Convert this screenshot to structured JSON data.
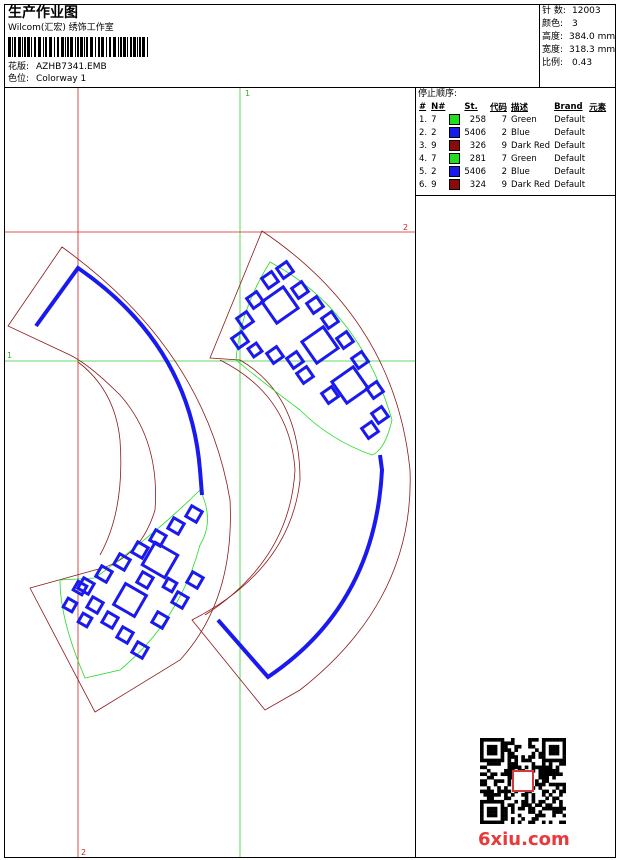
{
  "header": {
    "title": "生产作业图",
    "company": "Wilcom(汇宏) 绣饰工作室",
    "design_label": "花版:",
    "design_value": "AZHB7341.EMB",
    "colorway_label": "色位:",
    "colorway_value": "Colorway 1"
  },
  "stats": {
    "stitches_label": "针 数:",
    "stitches_value": "12003",
    "colors_label": "颜色:",
    "colors_value": "3",
    "height_label": "高度:",
    "height_value": "384.0 mm",
    "width_label": "宽度:",
    "width_value": "318.3 mm",
    "scale_label": "比例:",
    "scale_value": "0.43"
  },
  "stop_sequence": {
    "title": "停止顺序:",
    "headers": [
      "#",
      "N#",
      "St.",
      "代码",
      "描述",
      "Brand",
      "元素"
    ],
    "rows": [
      {
        "idx": "1.",
        "n": "7",
        "color": "#22dd22",
        "code": "258",
        "st": "7",
        "desc": "Green",
        "brand": "Default"
      },
      {
        "idx": "2.",
        "n": "2",
        "color": "#1a1aee",
        "code": "5406",
        "st": "2",
        "desc": "Blue",
        "brand": "Default"
      },
      {
        "idx": "3.",
        "n": "9",
        "color": "#8b0a0a",
        "code": "326",
        "st": "9",
        "desc": "Dark Red",
        "brand": "Default"
      },
      {
        "idx": "4.",
        "n": "7",
        "color": "#22dd22",
        "code": "281",
        "st": "7",
        "desc": "Green",
        "brand": "Default"
      },
      {
        "idx": "5.",
        "n": "2",
        "color": "#1a1aee",
        "code": "5406",
        "st": "2",
        "desc": "Blue",
        "brand": "Default"
      },
      {
        "idx": "6.",
        "n": "9",
        "color": "#8b0a0a",
        "code": "324",
        "st": "9",
        "desc": "Dark Red",
        "brand": "Default"
      }
    ]
  },
  "guides": {
    "v_green_label": "1",
    "v_red_label": "2",
    "h_green_label": "1",
    "h_red_label": "2"
  },
  "colors": {
    "guide_red": "#cc2222",
    "guide_green": "#33cc33",
    "outline": "#8b1a1a",
    "stitch": "#1a1aee",
    "fill_outline": "#22dd22"
  },
  "watermark": {
    "text": "6xiu.com",
    "qr_icon": "qr-code-icon"
  }
}
